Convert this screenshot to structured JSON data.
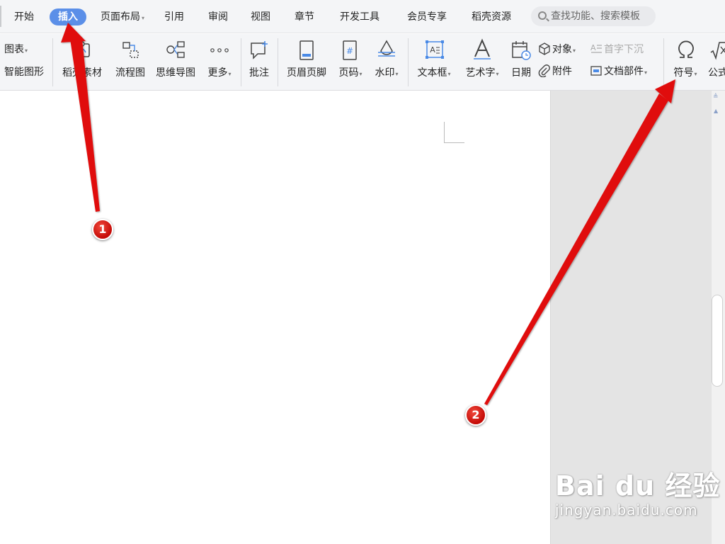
{
  "tabs": [
    {
      "label": "开始"
    },
    {
      "label": "插入",
      "active": true
    },
    {
      "label": "页面布局",
      "has_dropdown": true
    },
    {
      "label": "引用"
    },
    {
      "label": "审阅"
    },
    {
      "label": "视图"
    },
    {
      "label": "章节"
    },
    {
      "label": "开发工具"
    },
    {
      "label": "会员专享"
    },
    {
      "label": "稻壳资源"
    }
  ],
  "search": {
    "placeholder": "查找功能、搜索模板",
    "icon": "search-icon"
  },
  "ribbon": {
    "chart": {
      "label": "图表",
      "icon": "chart-icon"
    },
    "smart_shape": {
      "label": "智能图形",
      "icon": "smart-shape-icon"
    },
    "daoke_material": {
      "label": "稻壳素材",
      "icon": "material-icon"
    },
    "flowchart": {
      "label": "流程图",
      "icon": "flowchart-icon"
    },
    "mindmap": {
      "label": "思维导图",
      "icon": "mindmap-icon"
    },
    "more": {
      "label": "更多",
      "icon": "more-icon"
    },
    "comment": {
      "label": "批注",
      "icon": "comment-icon"
    },
    "header_footer": {
      "label": "页眉页脚",
      "icon": "header-footer-icon"
    },
    "page_number": {
      "label": "页码",
      "icon": "page-number-icon"
    },
    "watermark": {
      "label": "水印",
      "icon": "watermark-icon"
    },
    "textbox": {
      "label": "文本框",
      "icon": "textbox-icon"
    },
    "wordart": {
      "label": "艺术字",
      "icon": "wordart-icon"
    },
    "date": {
      "label": "日期",
      "icon": "calendar-icon"
    },
    "object": {
      "label": "对象",
      "icon": "object-icon"
    },
    "drop_cap": {
      "label": "首字下沉",
      "icon": "drop-cap-icon",
      "disabled": true
    },
    "attachment": {
      "label": "附件",
      "icon": "paperclip-icon"
    },
    "doc_parts": {
      "label": "文档部件",
      "icon": "doc-parts-icon"
    },
    "symbol": {
      "label": "符号",
      "icon": "omega-icon"
    },
    "formula": {
      "label": "公式",
      "icon": "formula-icon"
    }
  },
  "annotations": [
    {
      "number": "1",
      "points_to": "插入"
    },
    {
      "number": "2",
      "points_to": "符号"
    }
  ],
  "watermark": {
    "main": "Bai du 经验",
    "sub": "jingyan.baidu.com"
  },
  "colors": {
    "accent": "#5b8fe8",
    "annotation_red": "#e01010",
    "ribbon_bg": "#f4f5f7",
    "sidebar_grey": "#e4e4e4"
  }
}
